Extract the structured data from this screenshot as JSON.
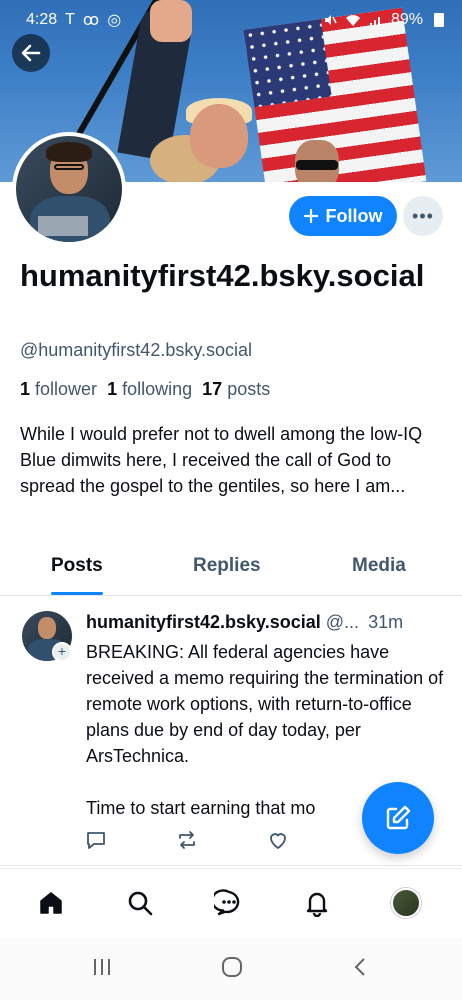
{
  "status_bar": {
    "time": "4:28",
    "left_icons": [
      "T",
      "ꝏ",
      "◎"
    ],
    "battery": "89%"
  },
  "profile": {
    "display_name": "humanityfirst42.bsky.social",
    "handle": "@humanityfirst42.bsky.social",
    "followers_count": "1",
    "followers_label": "follower",
    "following_count": "1",
    "following_label": "following",
    "posts_count": "17",
    "posts_label": "posts",
    "bio": "While I would prefer not to dwell among the low-IQ Blue dimwits here, I received the call of God to spread the gospel to the gentiles, so here I am...",
    "follow_label": "Follow",
    "more_label": "•••"
  },
  "tabs": [
    {
      "label": "Posts",
      "active": true
    },
    {
      "label": "Replies",
      "active": false
    },
    {
      "label": "Media",
      "active": false
    }
  ],
  "post": {
    "author": "humanityfirst42.bsky.social",
    "handle": "@...",
    "time": "31m",
    "paragraph_1": "BREAKING: All federal agencies have received a memo requiring the termination of remote work options, with return-to-office plans due by end of day today, per ArsTechnica.",
    "paragraph_2": "Time to start earning that mo"
  },
  "colors": {
    "accent": "#1083fe",
    "secondary_text": "#42576c",
    "primary_text": "#0b0f14"
  },
  "icons": {
    "back": "back-arrow-icon",
    "compose": "compose-icon",
    "nav": [
      "home-icon",
      "search-icon",
      "chat-icon",
      "bell-icon",
      "avatar"
    ]
  }
}
